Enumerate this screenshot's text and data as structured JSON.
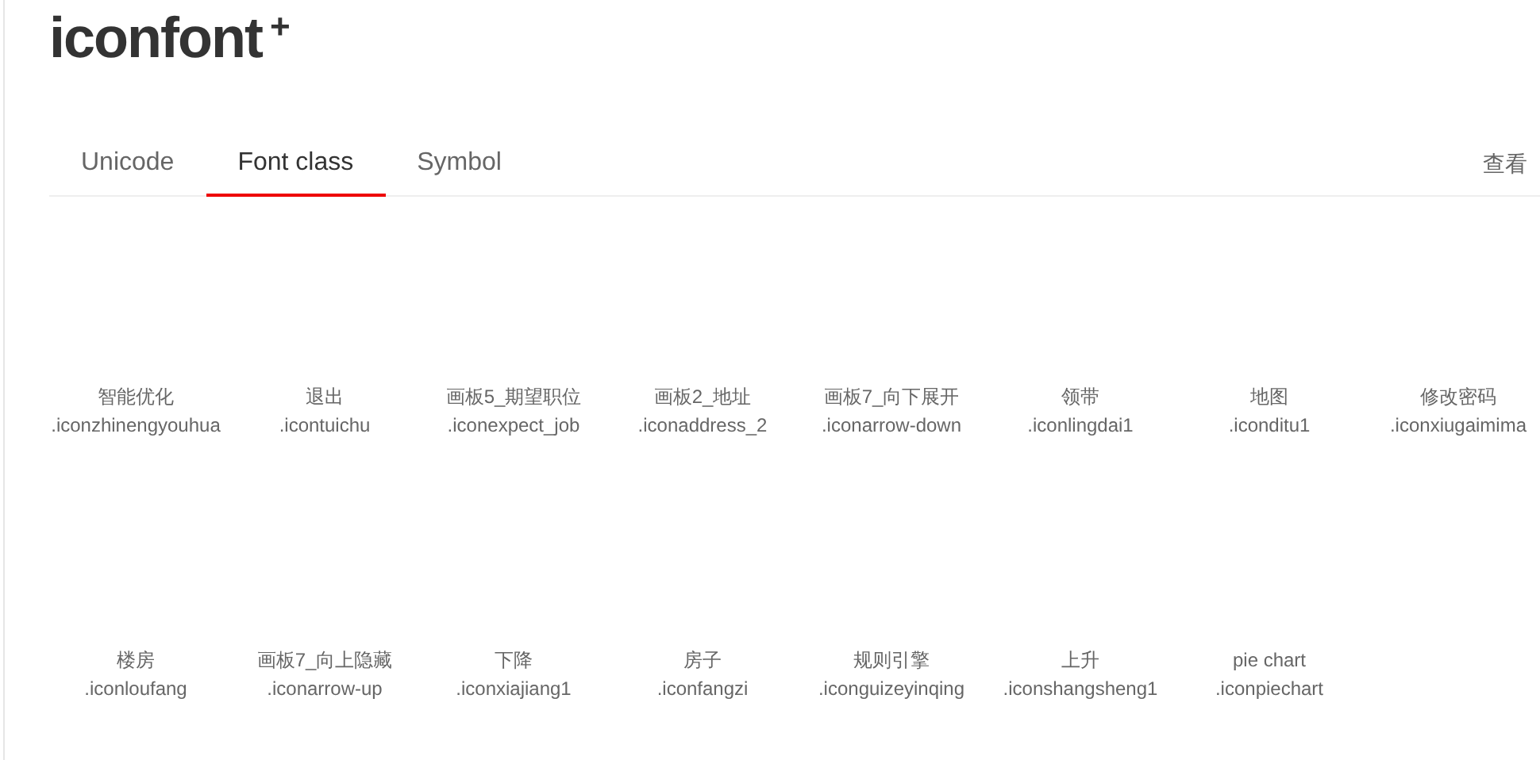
{
  "logo": {
    "text": "iconfont",
    "mark": "+"
  },
  "tabs": [
    {
      "label": "Unicode",
      "selected": false
    },
    {
      "label": "Font class",
      "selected": true
    },
    {
      "label": "Symbol",
      "selected": false
    }
  ],
  "tab_link": "查看",
  "icons": [
    {
      "name": "智能优化",
      "class": ".iconzhinengyouhua"
    },
    {
      "name": "退出",
      "class": ".icontuichu"
    },
    {
      "name": "画板5_期望职位",
      "class": ".iconexpect_job"
    },
    {
      "name": "画板2_地址",
      "class": ".iconaddress_2"
    },
    {
      "name": "画板7_向下展开",
      "class": ".iconarrow-down"
    },
    {
      "name": "领带",
      "class": ".iconlingdai1"
    },
    {
      "name": "地图",
      "class": ".iconditu1"
    },
    {
      "name": "修改密码",
      "class": ".iconxiugaimima"
    },
    {
      "name": "楼房",
      "class": ".iconloufang"
    },
    {
      "name": "画板7_向上隐藏",
      "class": ".iconarrow-up"
    },
    {
      "name": "下降",
      "class": ".iconxiajiang1"
    },
    {
      "name": "房子",
      "class": ".iconfangzi"
    },
    {
      "name": "规则引擎",
      "class": ".iconguizeyinqing"
    },
    {
      "name": "上升",
      "class": ".iconshangsheng1"
    },
    {
      "name": "pie chart",
      "class": ".iconpiechart"
    }
  ]
}
